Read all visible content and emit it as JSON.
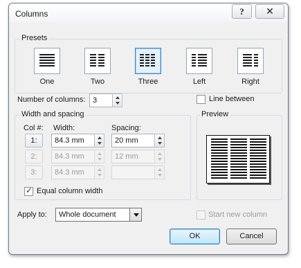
{
  "dialog": {
    "title": "Columns",
    "help_label": "?",
    "close_label": "✕"
  },
  "presets": {
    "label": "Presets",
    "items": [
      {
        "label": "One",
        "selected": false
      },
      {
        "label": "Two",
        "selected": false
      },
      {
        "label": "Three",
        "selected": true
      },
      {
        "label": "Left",
        "selected": false
      },
      {
        "label": "Right",
        "selected": false
      }
    ]
  },
  "number_of_columns": {
    "label": "Number of columns:",
    "value": "3"
  },
  "line_between": {
    "label": "Line between",
    "checked": false
  },
  "width_spacing": {
    "label": "Width and spacing",
    "col_header": "Col #:",
    "width_header": "Width:",
    "spacing_header": "Spacing:",
    "rows": [
      {
        "col": "1:",
        "width": "84.3 mm",
        "spacing": "20 mm",
        "enabled": true
      },
      {
        "col": "2:",
        "width": "84.3 mm",
        "spacing": "12 mm",
        "enabled": false
      },
      {
        "col": "3:",
        "width": "84.3 mm",
        "spacing": "",
        "enabled": false
      }
    ],
    "equal_width": {
      "label": "Equal column width",
      "checked": true
    }
  },
  "preview": {
    "label": "Preview",
    "columns": 3
  },
  "apply_to": {
    "label": "Apply to:",
    "value": "Whole document"
  },
  "start_new_column": {
    "label": "Start new column",
    "checked": false,
    "enabled": false
  },
  "buttons": {
    "ok": "OK",
    "cancel": "Cancel"
  }
}
